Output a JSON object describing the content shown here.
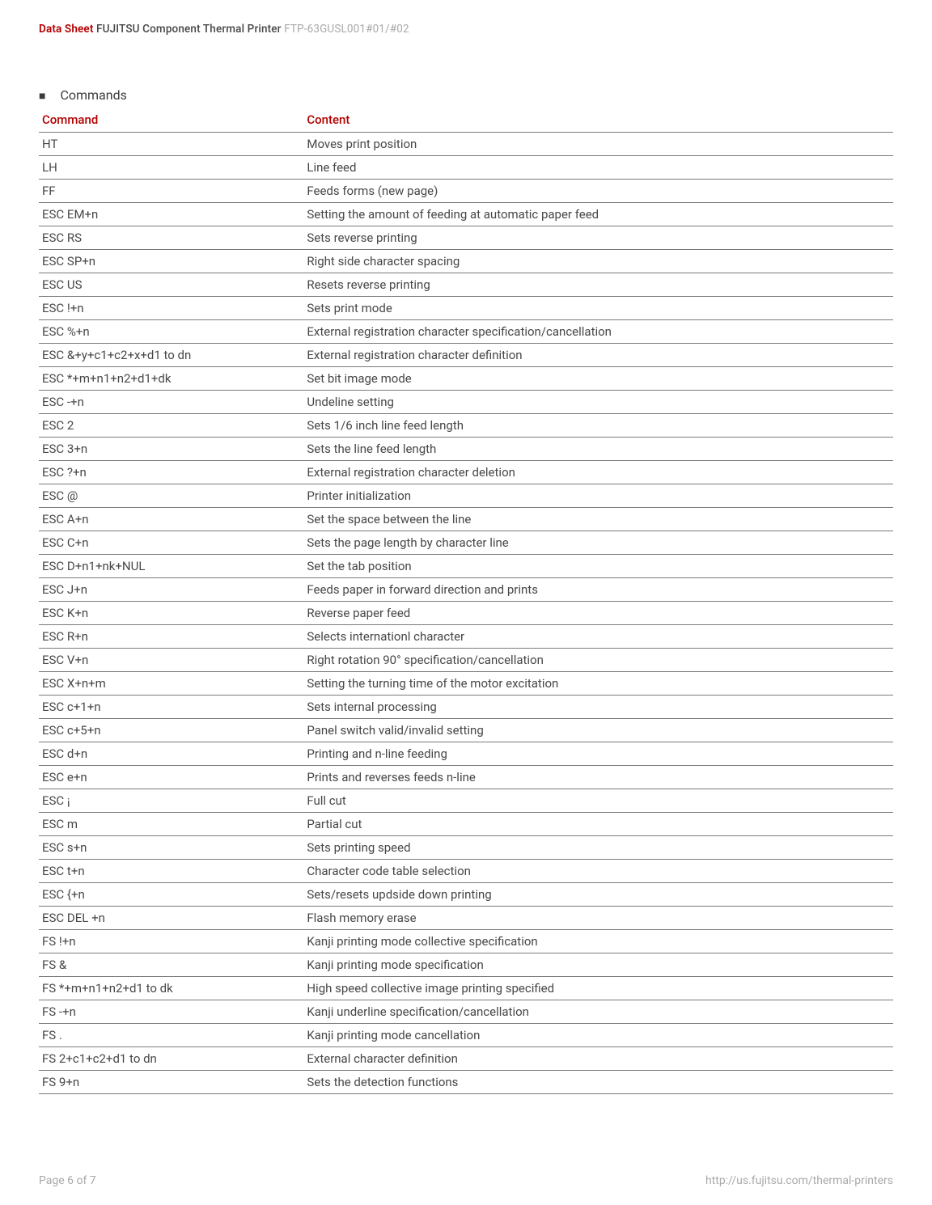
{
  "header": {
    "dataSheet": "Data Sheet",
    "product": "FUJITSU Component Thermal Printer",
    "model": "FTP-63GUSL001#01/#02"
  },
  "sectionTitle": "Commands",
  "tableHeaders": {
    "command": "Command",
    "content": "Content"
  },
  "commands": [
    {
      "cmd": "HT",
      "content": "Moves print position"
    },
    {
      "cmd": "LH",
      "content": "Line feed"
    },
    {
      "cmd": "FF",
      "content": "Feeds forms (new page)"
    },
    {
      "cmd": "ESC EM+n",
      "content": "Setting the amount of feeding at automatic paper feed"
    },
    {
      "cmd": "ESC RS",
      "content": "Sets reverse printing"
    },
    {
      "cmd": "ESC SP+n",
      "content": "Right side character spacing"
    },
    {
      "cmd": "ESC US",
      "content": "Resets reverse printing"
    },
    {
      "cmd": "ESC  !+n",
      "content": "Sets print mode"
    },
    {
      "cmd": "ESC %+n",
      "content": "External registration character specification/cancellation"
    },
    {
      "cmd": "ESC &+y+c1+c2+x+d1 to dn",
      "content": "External registration character definition"
    },
    {
      "cmd": "ESC *+m+n1+n2+d1+dk",
      "content": "Set bit image mode"
    },
    {
      "cmd": "ESC -+n",
      "content": "Undeline setting"
    },
    {
      "cmd": "ESC 2",
      "content": "Sets 1/6 inch line feed length"
    },
    {
      "cmd": "ESC 3+n",
      "content": "Sets the line feed length"
    },
    {
      "cmd": "ESC ?+n",
      "content": "External registration character deletion"
    },
    {
      "cmd": "ESC @",
      "content": "Printer initialization"
    },
    {
      "cmd": "ESC A+n",
      "content": "Set the space between the line"
    },
    {
      "cmd": "ESC C+n",
      "content": "Sets the page length by character line"
    },
    {
      "cmd": "ESC D+n1+nk+NUL",
      "content": "Set the tab position"
    },
    {
      "cmd": "ESC J+n",
      "content": "Feeds paper in forward direction and prints"
    },
    {
      "cmd": "ESC K+n",
      "content": "Reverse paper feed"
    },
    {
      "cmd": "ESC R+n",
      "content": "Selects internationl character"
    },
    {
      "cmd": "ESC V+n",
      "content": "Right rotation 90° specification/cancellation"
    },
    {
      "cmd": "ESC X+n+m",
      "content": "Setting the turning time of the motor excitation"
    },
    {
      "cmd": "ESC c+1+n",
      "content": "Sets internal processing"
    },
    {
      "cmd": "ESC c+5+n",
      "content": "Panel switch valid/invalid setting"
    },
    {
      "cmd": "ESC d+n",
      "content": "Printing and n-line feeding"
    },
    {
      "cmd": "ESC e+n",
      "content": "Prints and reverses feeds n-line"
    },
    {
      "cmd": "ESC ¡",
      "content": "Full cut"
    },
    {
      "cmd": "ESC m",
      "content": "Partial cut"
    },
    {
      "cmd": "ESC s+n",
      "content": "Sets printing speed"
    },
    {
      "cmd": "ESC t+n",
      "content": "Character code table selection"
    },
    {
      "cmd": "ESC {+n",
      "content": "Sets/resets updside down printing"
    },
    {
      "cmd": "ESC DEL +n",
      "content": "Flash memory erase"
    },
    {
      "cmd": "FS !+n",
      "content": "Kanji printing mode collective specification"
    },
    {
      "cmd": "FS &",
      "content": "Kanji printing mode specification"
    },
    {
      "cmd": "FS *+m+n1+n2+d1 to dk",
      "content": "High speed collective image printing specified"
    },
    {
      "cmd": "FS -+n",
      "content": "Kanji underline specification/cancellation"
    },
    {
      "cmd": "FS .",
      "content": "Kanji printing mode cancellation"
    },
    {
      "cmd": "FS 2+c1+c2+d1 to dn",
      "content": "External character definition"
    },
    {
      "cmd": "FS 9+n",
      "content": "Sets the detection functions"
    }
  ],
  "footer": {
    "page": "Page 6 of 7",
    "url": "http://us.fujitsu.com/thermal-printers"
  }
}
